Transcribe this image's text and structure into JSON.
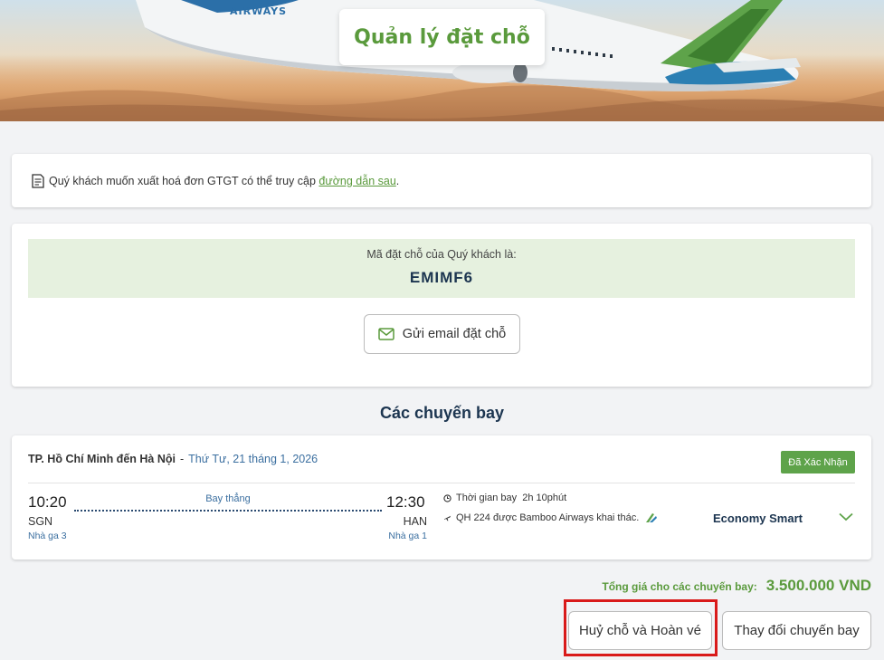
{
  "hero": {
    "title": "Quản lý đặt chỗ",
    "airline_mark": "AIRWAYS"
  },
  "invoice_notice": {
    "text": "Quý khách muốn xuất hoá đơn GTGT có thể truy cập ",
    "link_text": "đường dẫn sau",
    "suffix": "."
  },
  "booking": {
    "code_label": "Mã đặt chỗ của Quý khách là:",
    "code": "EMIMF6",
    "email_button": "Gửi email đặt chỗ"
  },
  "flights_section": {
    "title": "Các chuyến bay"
  },
  "flight": {
    "route": "TP. Hồ Chí Minh đến Hà Nội",
    "separator": "-",
    "date": "Thứ Tư, 21 tháng 1, 2026",
    "status": "Đã Xác Nhận",
    "depart_time": "10:20",
    "depart_airport": "SGN",
    "depart_terminal": "Nhà ga 3",
    "arrive_time": "12:30",
    "arrive_airport": "HAN",
    "arrive_terminal": "Nhà ga 1",
    "stop_type": "Bay thẳng",
    "duration": "Thời gian bay  2h 10phút",
    "operated_by": "QH 224 được Bamboo Airways khai thác.",
    "fare_class": "Economy Smart"
  },
  "summary": {
    "total_label": "Tổng giá cho các chuyến bay:",
    "total_value": "3.500.000 VND"
  },
  "actions": {
    "cancel_refund": "Huỷ chỗ và Hoàn vé",
    "change_flight": "Thay đổi chuyến bay"
  },
  "colors": {
    "brand_green": "#5a9a3c",
    "navy": "#1c3550",
    "link_blue": "#3b6fa0",
    "status_green": "#5ea34a",
    "highlight_red": "#d91a1a"
  }
}
